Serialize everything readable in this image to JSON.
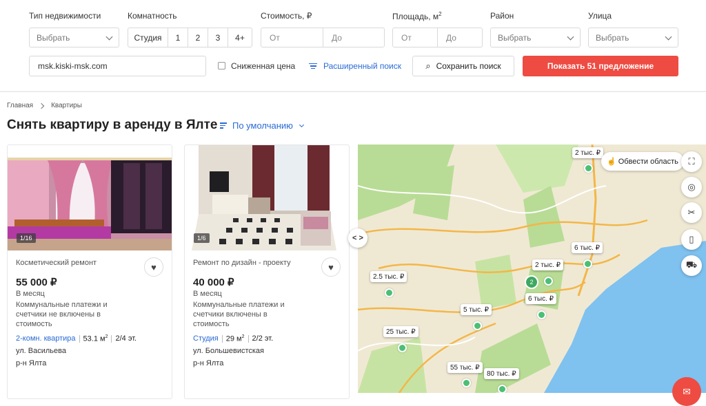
{
  "filters": {
    "type_label": "Тип недвижимости",
    "type_value": "Выбрать",
    "rooms_label": "Комнатность",
    "rooms": [
      "Студия",
      "1",
      "2",
      "3",
      "4+"
    ],
    "price_label": "Стоимость, ₽",
    "price_from": "От",
    "price_to": "До",
    "area_label": "Площадь, м",
    "area_unit_sup": "2",
    "area_from": "От",
    "area_to": "До",
    "district_label": "Район",
    "district_value": "Выбрать",
    "street_label": "Улица",
    "street_value": "Выбрать",
    "site_url": "msk.kiski-msk.com",
    "reduced_price": "Сниженная цена",
    "advanced_search": "Расширенный поиск",
    "save_search": "Сохранить поиск",
    "show_offers": "Показать 51 предложение"
  },
  "breadcrumb": {
    "home": "Главная",
    "current": "Квартиры"
  },
  "page_title": "Снять квартиру в аренду в Ялте",
  "sort_label": "По умолчанию",
  "listings": [
    {
      "counter": "1/16",
      "title": "Косметический ремонт",
      "price": "55 000 ₽",
      "period": "В месяц",
      "utilities": "Коммунальные платежи и счетчики не включены в стоимость",
      "rooms": "2-комн. квартира",
      "area": "53.1 м",
      "area_sup": "2",
      "floor": "2/4 эт.",
      "street": "ул. Васильева",
      "district": "р-н Ялта"
    },
    {
      "counter": "1/6",
      "title": "Ремонт по дизайн - проекту",
      "price": "40 000 ₽",
      "period": "В месяц",
      "utilities": "Коммунальные платежи и счетчики включены в стоимость",
      "rooms": "Студия",
      "area": "29 м",
      "area_sup": "2",
      "floor": "2/2 эт.",
      "street": "ул. Большевистская",
      "district": "р-н Ялта"
    }
  ],
  "map": {
    "toggle": "< >",
    "draw_area": "Обвести область",
    "price_pins": [
      "2 тыс. ₽",
      "6 тыс. ₽",
      "2 тыс. ₽",
      "2.5 тыс. ₽",
      "6 тыс. ₽",
      "5 тыс. ₽",
      "25 тыс. ₽",
      "55 тыс. ₽",
      "80 тыс. ₽"
    ],
    "cluster_count": "2",
    "colors": {
      "land": "#efe9d4",
      "sea": "#7fc1ef",
      "park": "#b8dc95",
      "road": "#f4b647",
      "pin_dot": "#4cbf74"
    }
  },
  "icons": {
    "fav": "heart-icon",
    "map_buttons": [
      "fullscreen-icon",
      "locate-icon",
      "ruler-icon",
      "traffic-light-icon",
      "car-icon"
    ],
    "chat": "chat-icon"
  },
  "accent_colors": {
    "primary_button": "#ee4b42",
    "link": "#2a6ad6"
  }
}
